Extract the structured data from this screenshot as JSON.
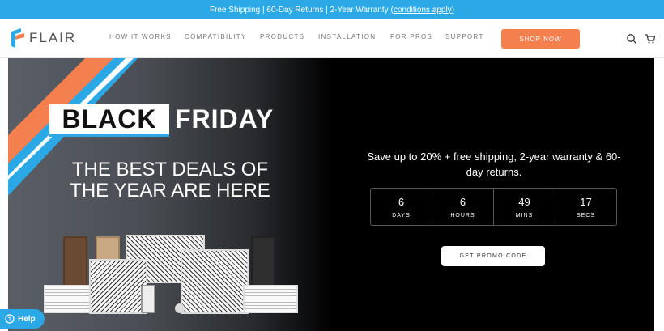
{
  "announcement": {
    "text": "Free Shipping | 60-Day Returns | 2-Year Warranty",
    "link_text": "(conditions apply)"
  },
  "header": {
    "logo_text": "FLAIR",
    "nav": [
      "HOW IT WORKS",
      "COMPATIBILITY",
      "PRODUCTS",
      "INSTALLATION",
      "FOR PROS",
      "SUPPORT"
    ],
    "cta": "SHOP NOW",
    "icons": [
      "search-icon",
      "cart-icon"
    ]
  },
  "hero": {
    "bf_word1": "BLACK",
    "bf_word2": "FRIDAY",
    "headline_line1": "THE BEST DEALS OF",
    "headline_line2": "THE YEAR ARE HERE",
    "promo_text": "Save up to 20% + free shipping, 2-year warranty & 60-day returns.",
    "countdown": [
      {
        "value": "6",
        "unit": "DAYS"
      },
      {
        "value": "6",
        "unit": "HOURS"
      },
      {
        "value": "49",
        "unit": "MINS"
      },
      {
        "value": "17",
        "unit": "SECS"
      }
    ],
    "promo_button": "GET PROMO CODE"
  },
  "help_button": "Help",
  "colors": {
    "accent_blue": "#2ba8e6",
    "accent_orange": "#f47f4f"
  }
}
